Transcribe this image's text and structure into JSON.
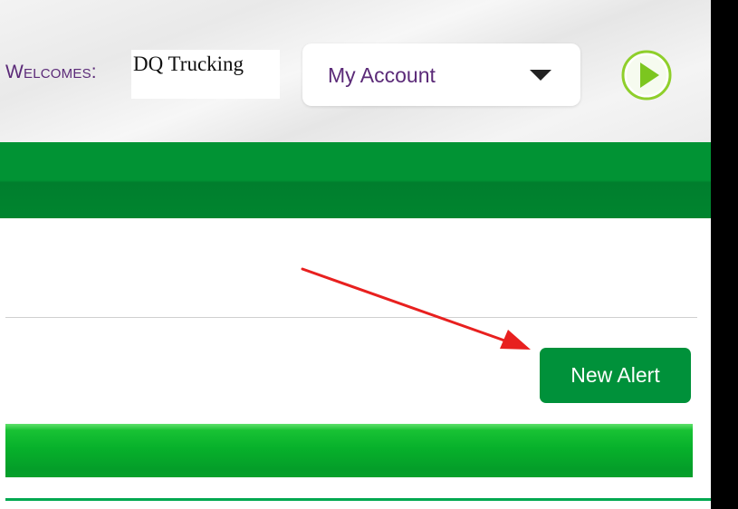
{
  "header": {
    "welcomes_label": "Welcomes:",
    "user_name": "DQ Trucking",
    "account_menu": {
      "label": "My Account",
      "icon": "caret-down-icon"
    },
    "go_icon": "play-circle-icon"
  },
  "toolbar": {
    "new_alert_label": "New Alert"
  },
  "colors": {
    "brand_green": "#019334",
    "button_green": "#00913a",
    "accent_purple": "#5b2a78",
    "annotation_red": "#e8201f"
  }
}
